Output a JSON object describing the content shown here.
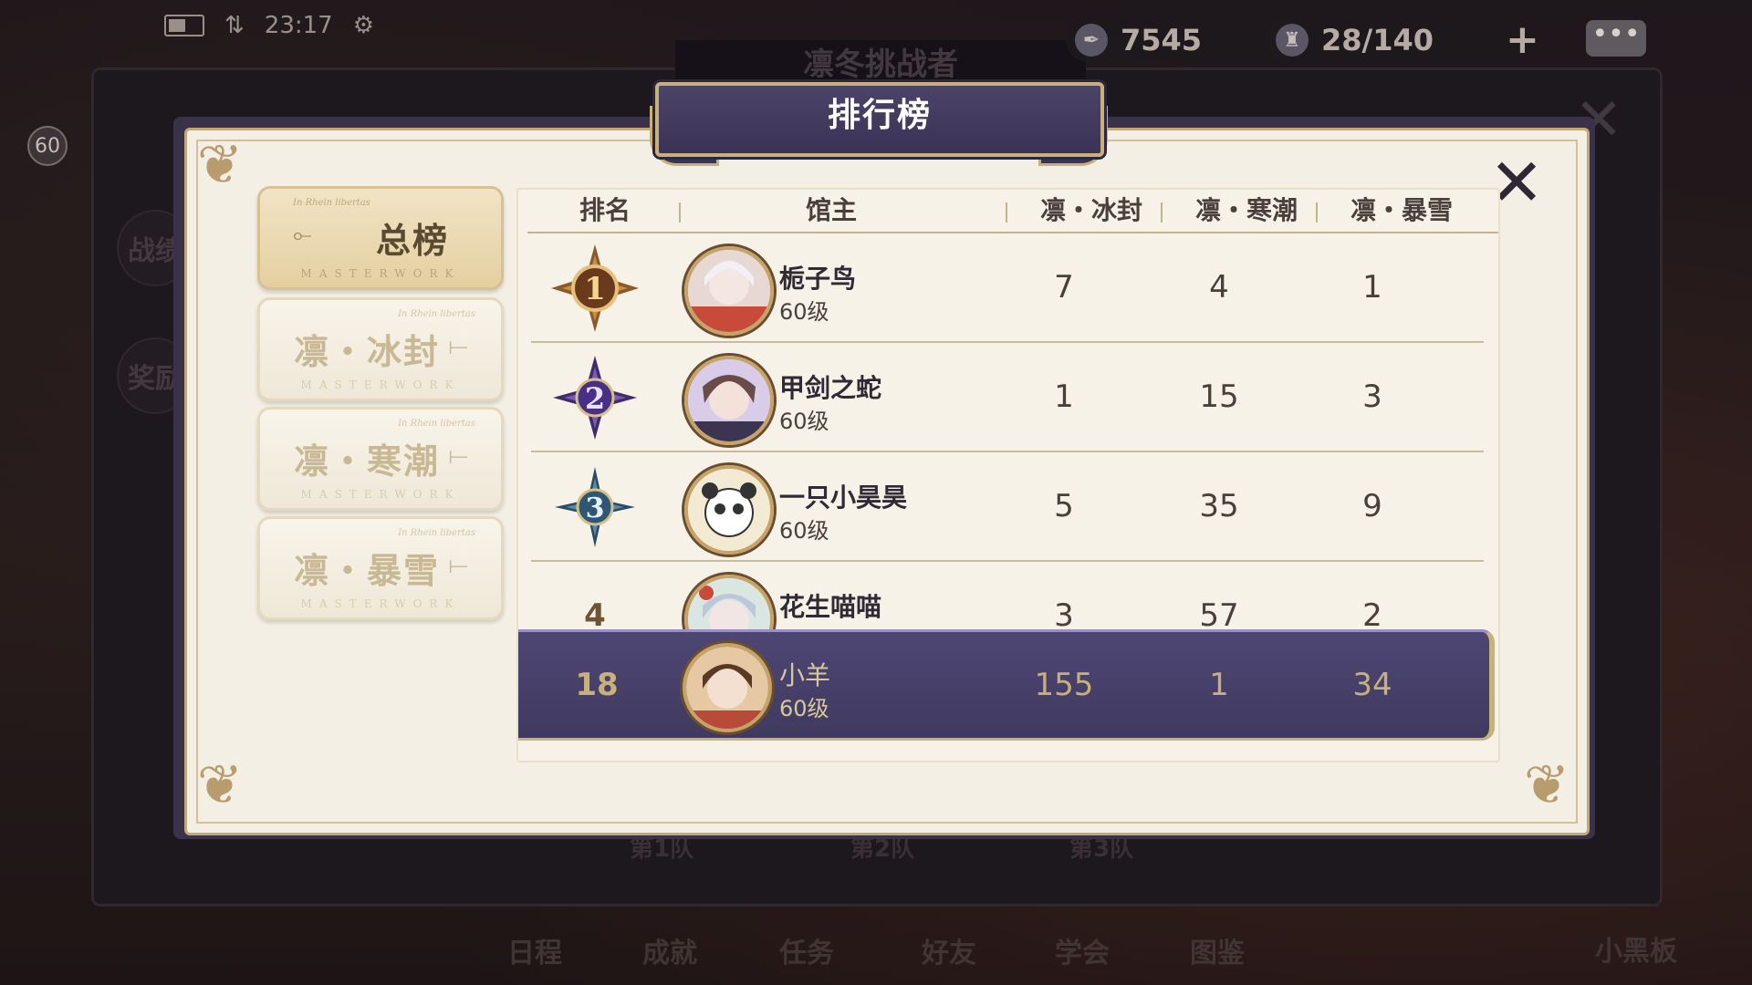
{
  "status": {
    "time": "23:17"
  },
  "resources": [
    {
      "icon": "feather-icon",
      "value": "7545"
    },
    {
      "icon": "stamina-icon",
      "value": "28/140"
    }
  ],
  "profile_level": "60",
  "background": {
    "title": "凛冬挑战者",
    "side_buttons": [
      "战绩",
      "奖励"
    ],
    "teams": [
      "第1队",
      "第2队",
      "第3队"
    ],
    "bottom_nav": [
      "日程",
      "成就",
      "任务",
      "好友",
      "学会",
      "图鉴",
      "小黑板"
    ]
  },
  "dialog": {
    "title": "排行榜",
    "tabs": [
      {
        "label": "总榜",
        "sub": "MASTERWORK",
        "tiny": "In Rhein libertas",
        "active": true
      },
      {
        "label": "凛・冰封",
        "sub": "MASTERWORK",
        "tiny": "In Rhein libertas",
        "active": false
      },
      {
        "label": "凛・寒潮",
        "sub": "MASTERWORK",
        "tiny": "In Rhein libertas",
        "active": false
      },
      {
        "label": "凛・暴雪",
        "sub": "MASTERWORK",
        "tiny": "In Rhein libertas",
        "active": false
      }
    ],
    "columns": [
      "排名",
      "馆主",
      "凛・冰封",
      "凛・寒潮",
      "凛・暴雪"
    ],
    "rows": [
      {
        "rank": "1",
        "name": "栀子鸟",
        "level": "60级",
        "c1": "7",
        "c2": "4",
        "c3": "1",
        "medal_color": "#b5772f"
      },
      {
        "rank": "2",
        "name": "甲剑之蛇",
        "level": "60级",
        "c1": "1",
        "c2": "15",
        "c3": "3",
        "medal_color": "#5b3f93"
      },
      {
        "rank": "3",
        "name": "一只小昊昊",
        "level": "60级",
        "c1": "5",
        "c2": "35",
        "c3": "9",
        "medal_color": "#3e6a86"
      },
      {
        "rank": "4",
        "name": "花生喵喵",
        "level": "",
        "c1": "3",
        "c2": "57",
        "c3": "2"
      }
    ],
    "self": {
      "rank": "18",
      "name": "小羊",
      "level": "60级",
      "c1": "155",
      "c2": "1",
      "c3": "34"
    }
  }
}
